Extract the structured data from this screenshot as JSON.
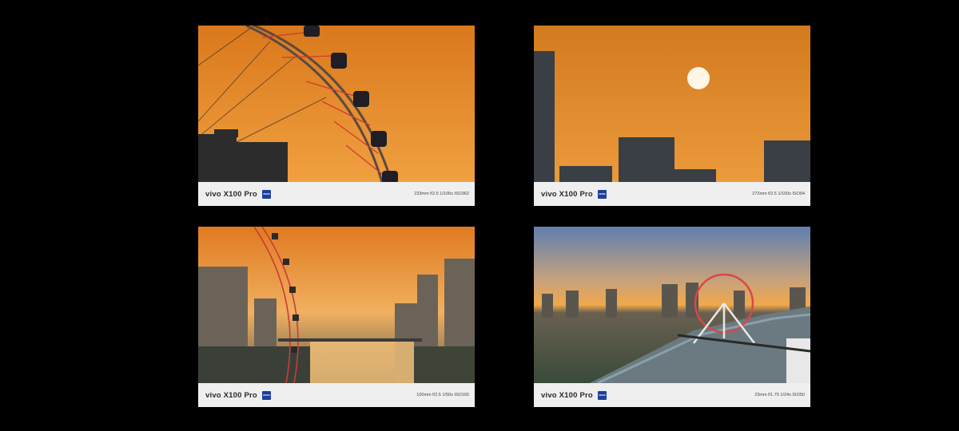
{
  "photos": [
    {
      "brand": "vivo X100 Pro",
      "exif": "233mm  f/2.5  1/100s  ISO362"
    },
    {
      "brand": "vivo X100 Pro",
      "exif": "272mm  f/2.5  1/100s  ISO94"
    },
    {
      "brand": "vivo X100 Pro",
      "exif": "100mm  f/2.5  1/50s  ISO165"
    },
    {
      "brand": "vivo X100 Pro",
      "exif": "23mm  f/1.75  1/24s  ISO50"
    }
  ],
  "colors": {
    "background": "#000000",
    "sky": "#e8902e",
    "zeiss_badge": "#1d3f9e",
    "ferris_wheel": "#d94040"
  },
  "icons": {
    "logo": "zeiss-logo-icon"
  }
}
